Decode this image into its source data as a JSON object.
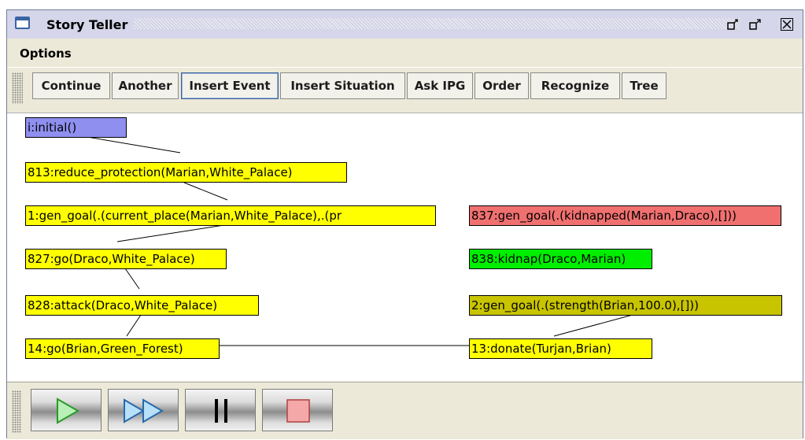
{
  "window": {
    "title": "Story Teller",
    "controls": [
      "minimize-icon",
      "maximize-icon",
      "close-icon"
    ]
  },
  "menu": {
    "options_label": "Options"
  },
  "toolbar": {
    "buttons": [
      {
        "label": "Continue"
      },
      {
        "label": "Another"
      },
      {
        "label": "Insert Event"
      },
      {
        "label": "Insert Situation"
      },
      {
        "label": "Ask IPG"
      },
      {
        "label": "Order"
      },
      {
        "label": "Recognize"
      },
      {
        "label": "Tree"
      }
    ]
  },
  "graph": {
    "nodes": [
      {
        "id": "n_initial",
        "label": "i:initial()",
        "color": "#8f8ff0"
      },
      {
        "id": "n_813",
        "label": "813:reduce_protection(Marian,White_Palace)",
        "color": "#ffff00"
      },
      {
        "id": "n_1",
        "label": "1:gen_goal(.(current_place(Marian,White_Palace),.(pr",
        "color": "#ffff00"
      },
      {
        "id": "n_827",
        "label": "827:go(Draco,White_Palace)",
        "color": "#ffff00"
      },
      {
        "id": "n_828",
        "label": "828:attack(Draco,White_Palace)",
        "color": "#ffff00"
      },
      {
        "id": "n_14",
        "label": "14:go(Brian,Green_Forest)",
        "color": "#ffff00"
      },
      {
        "id": "n_837",
        "label": "837:gen_goal(.(kidnapped(Marian,Draco),[]))",
        "color": "#f07070"
      },
      {
        "id": "n_838",
        "label": "838:kidnap(Draco,Marian)",
        "color": "#00ee00"
      },
      {
        "id": "n_2",
        "label": "2:gen_goal(.(strength(Brian,100.0),[]))",
        "color": "#c8c400"
      },
      {
        "id": "n_13",
        "label": "13:donate(Turjan,Brian)",
        "color": "#ffff00"
      }
    ],
    "edges": [
      [
        "n_initial",
        "n_813"
      ],
      [
        "n_813",
        "n_1"
      ],
      [
        "n_1",
        "n_827"
      ],
      [
        "n_827",
        "n_828"
      ],
      [
        "n_828",
        "n_14"
      ],
      [
        "n_14",
        "n_13"
      ],
      [
        "n_2",
        "n_13"
      ]
    ]
  },
  "playback": {
    "buttons": [
      "play-icon",
      "fast-forward-icon",
      "pause-icon",
      "stop-icon"
    ]
  }
}
